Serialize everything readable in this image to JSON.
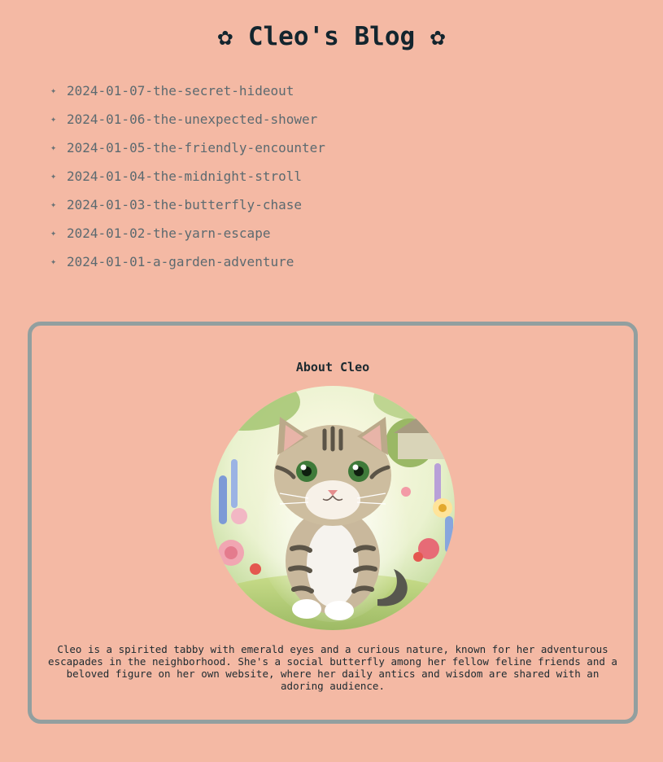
{
  "header": {
    "title": "✿ Cleo's Blog ✿"
  },
  "posts": [
    {
      "label": "2024-01-07-the-secret-hideout"
    },
    {
      "label": "2024-01-06-the-unexpected-shower"
    },
    {
      "label": "2024-01-05-the-friendly-encounter"
    },
    {
      "label": "2024-01-04-the-midnight-stroll"
    },
    {
      "label": "2024-01-03-the-butterfly-chase"
    },
    {
      "label": "2024-01-02-the-yarn-escape"
    },
    {
      "label": "2024-01-01-a-garden-adventure"
    }
  ],
  "bullet_icon": "sparkle-icon",
  "about": {
    "title": "About Cleo",
    "image_subject": "tabby kitten in a garden",
    "description": "Cleo is a spirited tabby with emerald eyes and a curious nature, known for her adventurous escapades in the neighborhood. She's a social butterfly among her fellow feline friends and a beloved figure on her own website, where her daily antics and wisdom are shared with an adoring audience."
  },
  "colors": {
    "background": "#f4b9a4",
    "card_border": "#929f9f",
    "link": "#5c6a70",
    "title": "#13252e"
  }
}
